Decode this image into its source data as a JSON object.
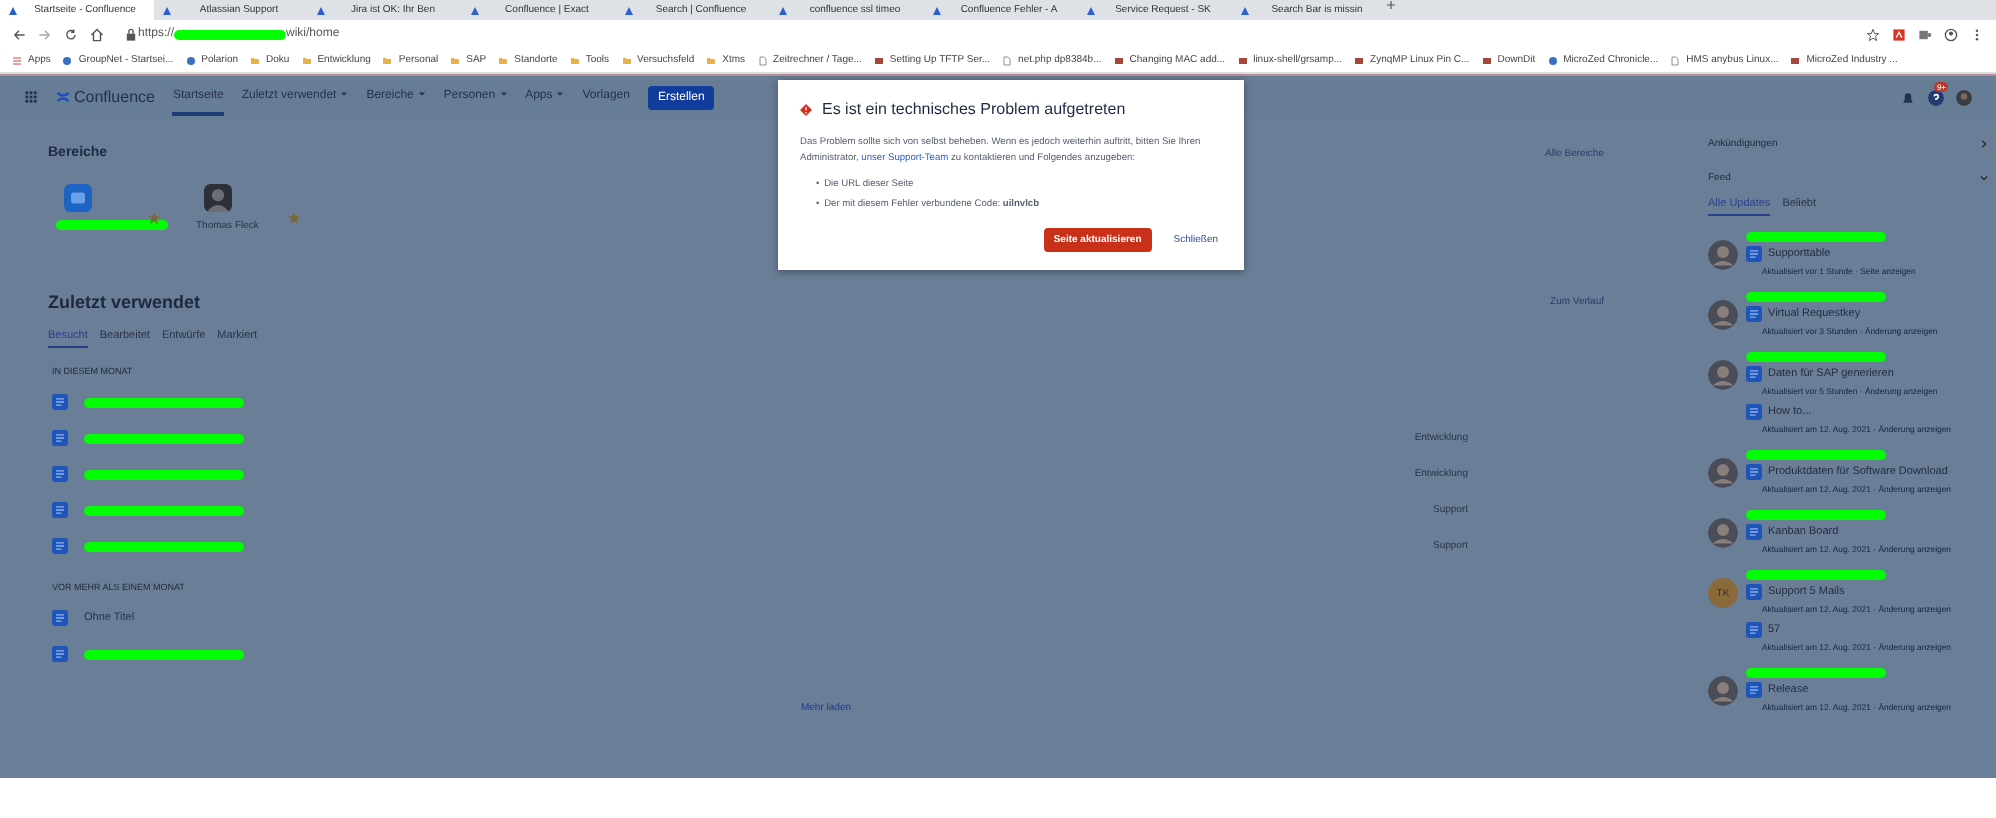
{
  "browser": {
    "tabs": [
      {
        "title": "Startseite - Confluence",
        "selected": true
      },
      {
        "title": "Atlassian Support",
        "selected": false
      },
      {
        "title": "Jira ist OK: Ihr Ben",
        "selected": false
      },
      {
        "title": "Confluence | Exact",
        "selected": false
      },
      {
        "title": "Search | Confluence",
        "selected": false
      },
      {
        "title": "confluence ssl timeo",
        "selected": false
      },
      {
        "title": "Confluence Fehler - A",
        "selected": false
      },
      {
        "title": "Service Request - SK",
        "selected": false
      },
      {
        "title": "Search Bar is missin",
        "selected": false
      }
    ],
    "url_start": "https://",
    "url_end": "wiki/home",
    "bookmarks": [
      {
        "label": "Apps",
        "kind": "apps"
      },
      {
        "label": "GroupNet - Startsei...",
        "kind": "globe"
      },
      {
        "label": "Polarion",
        "kind": "globe"
      },
      {
        "label": "Doku",
        "kind": "folder"
      },
      {
        "label": "Entwicklung",
        "kind": "folder"
      },
      {
        "label": "Personal",
        "kind": "folder"
      },
      {
        "label": "SAP",
        "kind": "folder"
      },
      {
        "label": "Standorte",
        "kind": "folder"
      },
      {
        "label": "Tools",
        "kind": "folder"
      },
      {
        "label": "Versuchsfeld",
        "kind": "folder"
      },
      {
        "label": "Xtms",
        "kind": "folder"
      },
      {
        "label": "Zeitrechner / Tage...",
        "kind": "page"
      },
      {
        "label": "Setting Up TFTP Ser...",
        "kind": "site"
      },
      {
        "label": "net.php dp8384b...",
        "kind": "page"
      },
      {
        "label": "Changing MAC add...",
        "kind": "site"
      },
      {
        "label": "linux-shell/grsamp...",
        "kind": "site"
      },
      {
        "label": "ZynqMP Linux Pin C...",
        "kind": "site"
      },
      {
        "label": "DownDit",
        "kind": "site"
      },
      {
        "label": "MicroZed Chronicle...",
        "kind": "globe"
      },
      {
        "label": "HMS anybus Linux...",
        "kind": "page"
      },
      {
        "label": "MicroZed Industry ...",
        "kind": "site"
      }
    ]
  },
  "nav": {
    "logo": "Confluence",
    "items": [
      {
        "label": "Startseite",
        "selected": true,
        "dropdown": false
      },
      {
        "label": "Zuletzt verwendet",
        "selected": false,
        "dropdown": true
      },
      {
        "label": "Bereiche",
        "selected": false,
        "dropdown": true
      },
      {
        "label": "Personen",
        "selected": false,
        "dropdown": true
      },
      {
        "label": "Apps",
        "selected": false,
        "dropdown": true
      },
      {
        "label": "Vorlagen",
        "selected": false,
        "dropdown": false
      }
    ],
    "create": "Erstellen",
    "notification_count": "9+"
  },
  "spaces": {
    "title": "Bereiche",
    "link": "Alle Bereiche",
    "items": [
      {
        "name_redacted": true,
        "kind": "space",
        "starred": true
      },
      {
        "name": "Thomas Fleck",
        "kind": "person",
        "starred": true
      }
    ]
  },
  "recent": {
    "title": "Zuletzt verwendet",
    "link": "Zum Verlauf",
    "tabs": [
      {
        "label": "Besucht",
        "selected": true
      },
      {
        "label": "Bearbeitet",
        "selected": false
      },
      {
        "label": "Entwürfe",
        "selected": false
      },
      {
        "label": "Markiert",
        "selected": false
      }
    ],
    "groups": [
      {
        "heading": "IN DIESEM MONAT",
        "items": [
          {
            "title_redacted": true
          },
          {
            "title_redacted": true,
            "space": "Entwicklung"
          },
          {
            "title_redacted": true,
            "space": "Entwicklung"
          },
          {
            "title_redacted": true,
            "space": "Support"
          },
          {
            "title_redacted": true,
            "space": "Support"
          }
        ]
      },
      {
        "heading": "VOR MEHR ALS EINEM MONAT",
        "items": [
          {
            "title": "Ohne Titel"
          },
          {
            "title_redacted": true
          }
        ]
      }
    ],
    "more": "Mehr laden"
  },
  "sidebar": {
    "announcements": "Ankündigungen",
    "feed": "Feed",
    "tabs": [
      {
        "label": "Alle Updates",
        "selected": true
      },
      {
        "label": "Beliebt",
        "selected": false
      }
    ],
    "entries": [
      {
        "kind": "photo",
        "pages": [
          {
            "title": "Supporttable",
            "meta": "Aktualisiert vor 1 Stunde · Seite anzeigen"
          }
        ]
      },
      {
        "kind": "photo",
        "pages": [
          {
            "title": "Virtual Requestkey",
            "meta": "Aktualisiert vor 3 Stunden · Änderung anzeigen"
          }
        ]
      },
      {
        "kind": "photo",
        "pages": [
          {
            "title": "Daten für SAP generieren",
            "meta": "Aktualisiert vor 5 Stunden · Änderung anzeigen"
          },
          {
            "title": "How to...",
            "meta": "Aktualisiert am 12. Aug. 2021 · Änderung anzeigen"
          }
        ]
      },
      {
        "kind": "photo",
        "pages": [
          {
            "title": "Produktdaten für Software Download",
            "meta": "Aktualisiert am 12. Aug. 2021 · Änderung anzeigen"
          }
        ]
      },
      {
        "kind": "photo",
        "pages": [
          {
            "title": "Kanban Board",
            "meta": "Aktualisiert am 12. Aug. 2021 · Änderung anzeigen"
          }
        ]
      },
      {
        "kind": "initials",
        "initials": "TK",
        "pages": [
          {
            "title": "Support 5 Mails",
            "meta": "Aktualisiert am 12. Aug. 2021 · Änderung anzeigen"
          },
          {
            "title": "57",
            "meta": "Aktualisiert am 12. Aug. 2021 · Änderung anzeigen"
          }
        ]
      },
      {
        "kind": "photo",
        "pages": [
          {
            "title": "Release",
            "meta": "Aktualisiert am 12. Aug. 2021 · Änderung anzeigen"
          }
        ]
      }
    ]
  },
  "dialog": {
    "title": "Es ist ein technisches Problem aufgetreten",
    "message": "Das Problem sollte sich von selbst beheben. Wenn es jedoch weiterhin auftritt, bitten Sie Ihren Administrator, ",
    "link": "unser Support-Team",
    "message_end": " zu kontaktieren und Folgendes anzugeben:",
    "bullets": [
      {
        "marker": "•",
        "text": "Die URL dieser Seite"
      },
      {
        "marker": "•",
        "text": "Der mit diesem Fehler verbundene Code: **uilnvlcb**"
      }
    ],
    "primary": "Seite aktualisieren",
    "secondary": "Schließen"
  }
}
